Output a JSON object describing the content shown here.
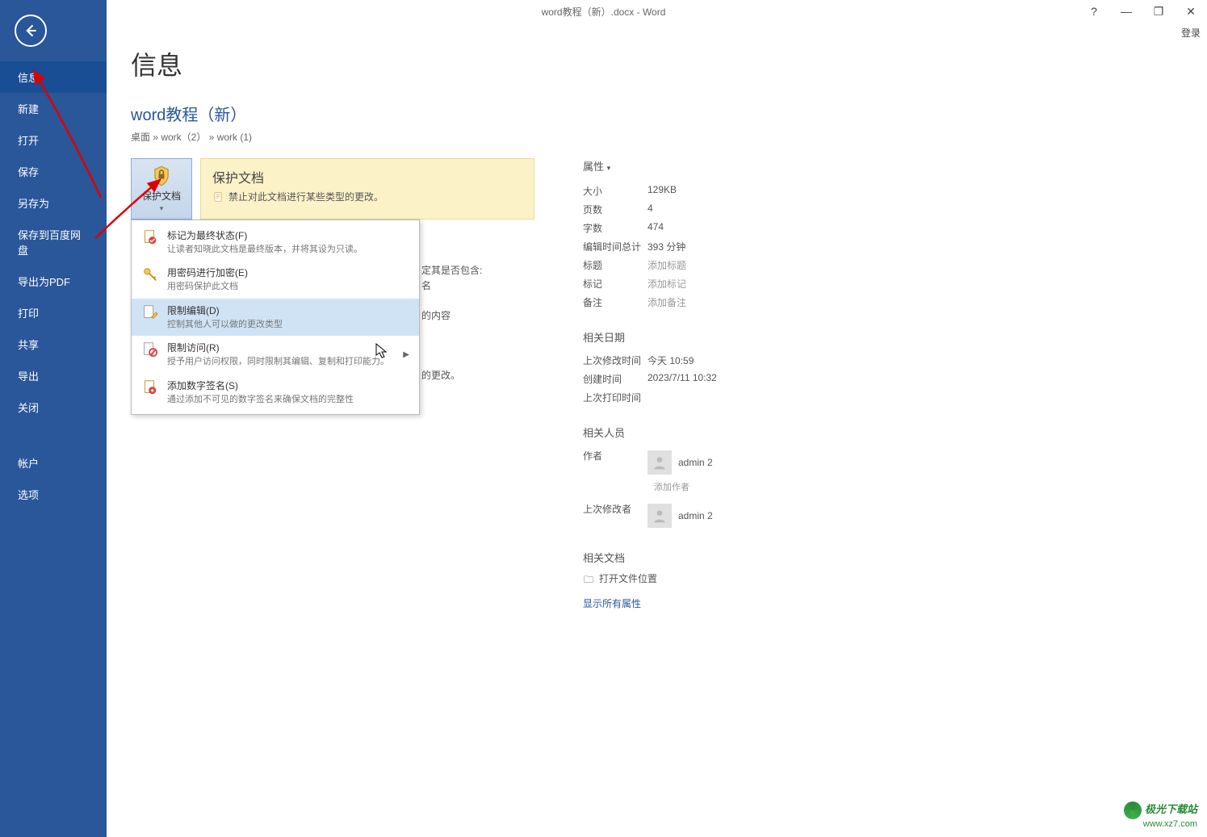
{
  "window": {
    "title_full": "word教程（新）.docx - Word",
    "help_glyph": "?",
    "minimize_glyph": "—",
    "restore_glyph": "❐",
    "close_glyph": "✕",
    "login_label": "登录"
  },
  "sidebar": {
    "items": [
      {
        "label": "信息",
        "selected": true
      },
      {
        "label": "新建"
      },
      {
        "label": "打开"
      },
      {
        "label": "保存"
      },
      {
        "label": "另存为"
      },
      {
        "label": "保存到百度网盘"
      },
      {
        "label": "导出为PDF"
      },
      {
        "label": "打印"
      },
      {
        "label": "共享"
      },
      {
        "label": "导出"
      },
      {
        "label": "关闭"
      },
      {
        "label": "帐户",
        "gap_before": true
      },
      {
        "label": "选项"
      }
    ]
  },
  "page": {
    "title": "信息",
    "doc_title": "word教程（新）",
    "breadcrumb": "桌面 » work（2） » work (1)"
  },
  "protect": {
    "button_label": "保护文档",
    "panel_title": "保护文档",
    "panel_desc": "禁止对此文档进行某些类型的更改。"
  },
  "dropdown": [
    {
      "title": "标记为最终状态(F)",
      "desc": "让读者知晓此文档是最终版本，并将其设为只读。",
      "icon": "doc-check"
    },
    {
      "title": "用密码进行加密(E)",
      "desc": "用密码保护此文档",
      "icon": "key-lock"
    },
    {
      "title": "限制编辑(D)",
      "desc": "控制其他人可以做的更改类型",
      "icon": "doc-pencil",
      "hover": true
    },
    {
      "title": "限制访问(R)",
      "desc": "授予用户访问权限，同时限制其编辑、复制和打印能力。",
      "icon": "doc-block",
      "submenu": true
    },
    {
      "title": "添加数字签名(S)",
      "desc": "通过添加不可见的数字签名来确保文档的完整性",
      "icon": "doc-sign"
    }
  ],
  "peek": {
    "line1a": "定其是否包含:",
    "line1b": "名",
    "line2": "的内容",
    "line3": "的更改。"
  },
  "properties": {
    "header": "属性",
    "rows": [
      {
        "k": "大小",
        "v": "129KB"
      },
      {
        "k": "页数",
        "v": "4"
      },
      {
        "k": "字数",
        "v": "474"
      },
      {
        "k": "编辑时间总计",
        "v": "393 分钟"
      },
      {
        "k": "标题",
        "v": "添加标题",
        "placeholder": true
      },
      {
        "k": "标记",
        "v": "添加标记",
        "placeholder": true
      },
      {
        "k": "备注",
        "v": "添加备注",
        "placeholder": true
      }
    ]
  },
  "dates": {
    "header": "相关日期",
    "rows": [
      {
        "k": "上次修改时间",
        "v": "今天 10:59"
      },
      {
        "k": "创建时间",
        "v": "2023/7/11 10:32"
      },
      {
        "k": "上次打印时间",
        "v": ""
      }
    ]
  },
  "people": {
    "header": "相关人员",
    "author_label": "作者",
    "author_name": "admin 2",
    "add_author": "添加作者",
    "modifier_label": "上次修改者",
    "modifier_name": "admin 2"
  },
  "related_docs": {
    "header": "相关文档",
    "open_location": "打开文件位置",
    "show_all": "显示所有属性"
  },
  "watermark": {
    "line1": "极光下载站",
    "line2": "www.xz7.com"
  }
}
